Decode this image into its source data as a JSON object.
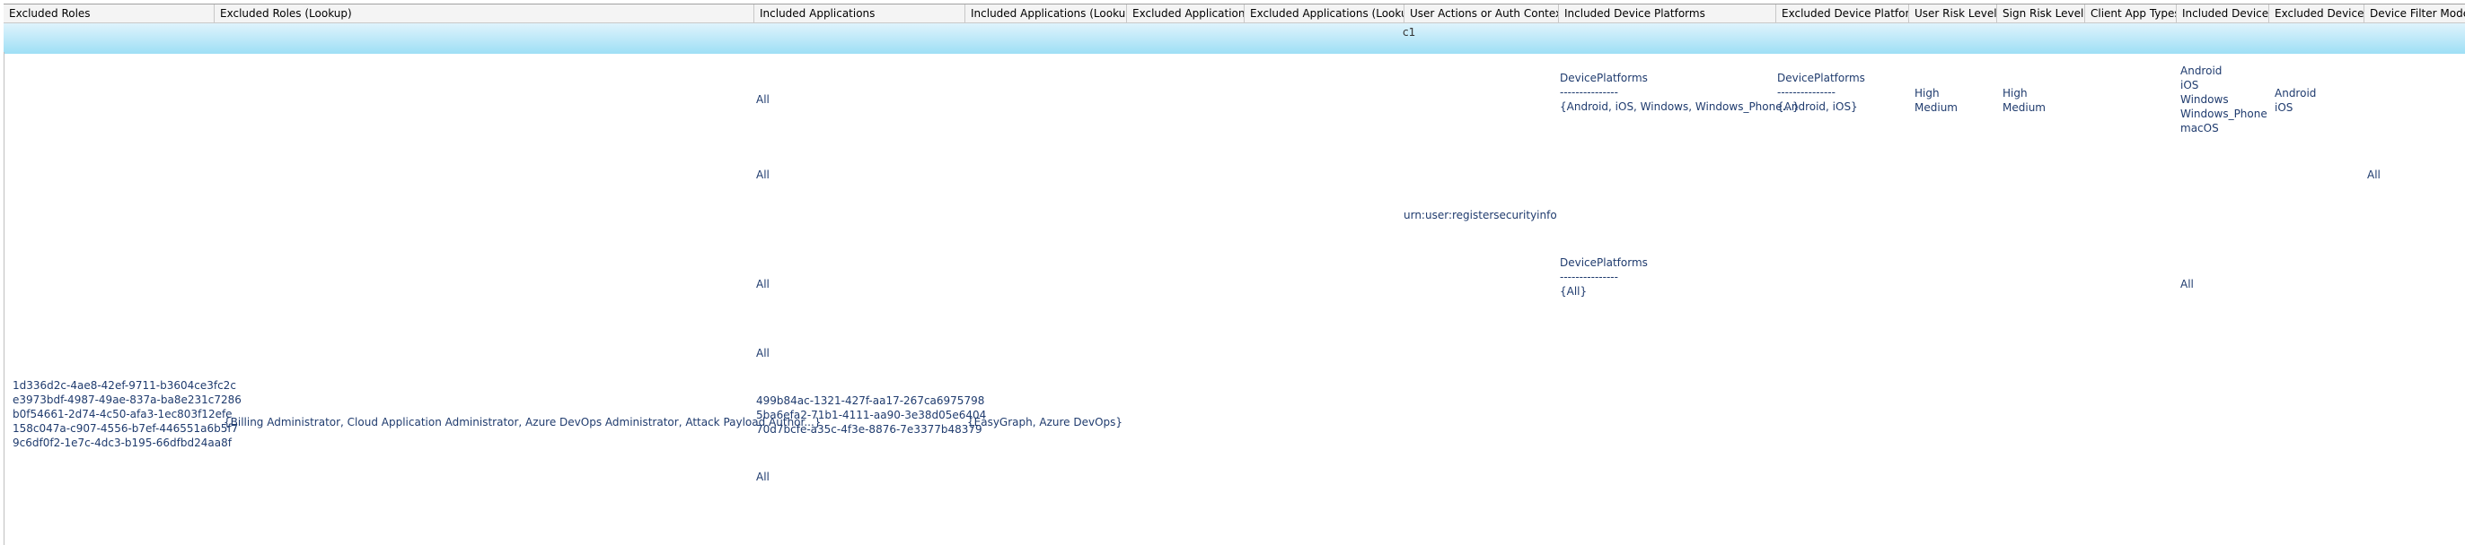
{
  "columns": [
    "Excluded Roles",
    "Excluded Roles (Lookup)",
    "Included Applications",
    "Included Applications (Lookup)",
    "Excluded Applications",
    "Excluded Applications (Lookup)",
    "User Actions or Auth Contexts",
    "Included Device Platforms",
    "Excluded Device Platforms",
    "User Risk Levels",
    "Sign Risk Levels",
    "Client App Types",
    "Included Devices",
    "Excluded Devices",
    "Device Filter Mode"
  ],
  "group_label": "c1",
  "rows": [
    {
      "included_applications": "All",
      "included_device_platforms": "DevicePlatforms\n---------------\n{Android, iOS, Windows, Windows_Phone...}",
      "excluded_device_platforms": "DevicePlatforms\n---------------\n{Android, iOS}",
      "user_risk_levels": "High\nMedium",
      "sign_risk_levels": "High\nMedium",
      "included_devices": "Android\niOS\nWindows\nWindows_Phone\nmacOS",
      "excluded_devices": "Android\niOS"
    },
    {
      "included_applications": "All",
      "device_filter_mode": "All"
    },
    {
      "user_actions": "urn:user:registersecurityinfo"
    },
    {
      "included_applications": "All",
      "included_device_platforms": "DevicePlatforms\n---------------\n{All}",
      "included_devices": "All"
    },
    {
      "included_applications": "All"
    },
    {
      "excluded_roles": "1d336d2c-4ae8-42ef-9711-b3604ce3fc2c\ne3973bdf-4987-49ae-837a-ba8e231c7286\nb0f54661-2d74-4c50-afa3-1ec803f12efe\n158c047a-c907-4556-b7ef-446551a6b5f7\n9c6df0f2-1e7c-4dc3-b195-66dfbd24aa8f",
      "excluded_roles_lookup": "{Billing Administrator, Cloud Application Administrator, Azure DevOps Administrator, Attack Payload Author...}",
      "included_applications": "499b84ac-1321-427f-aa17-267ca6975798\n5ba6efa2-71b1-4111-aa90-3e38d05e6404\n70d7bcfe-a35c-4f3e-8876-7e3377b48379",
      "included_applications_lookup": "{EasyGraph, Azure DevOps}"
    },
    {
      "included_applications": "All"
    }
  ]
}
